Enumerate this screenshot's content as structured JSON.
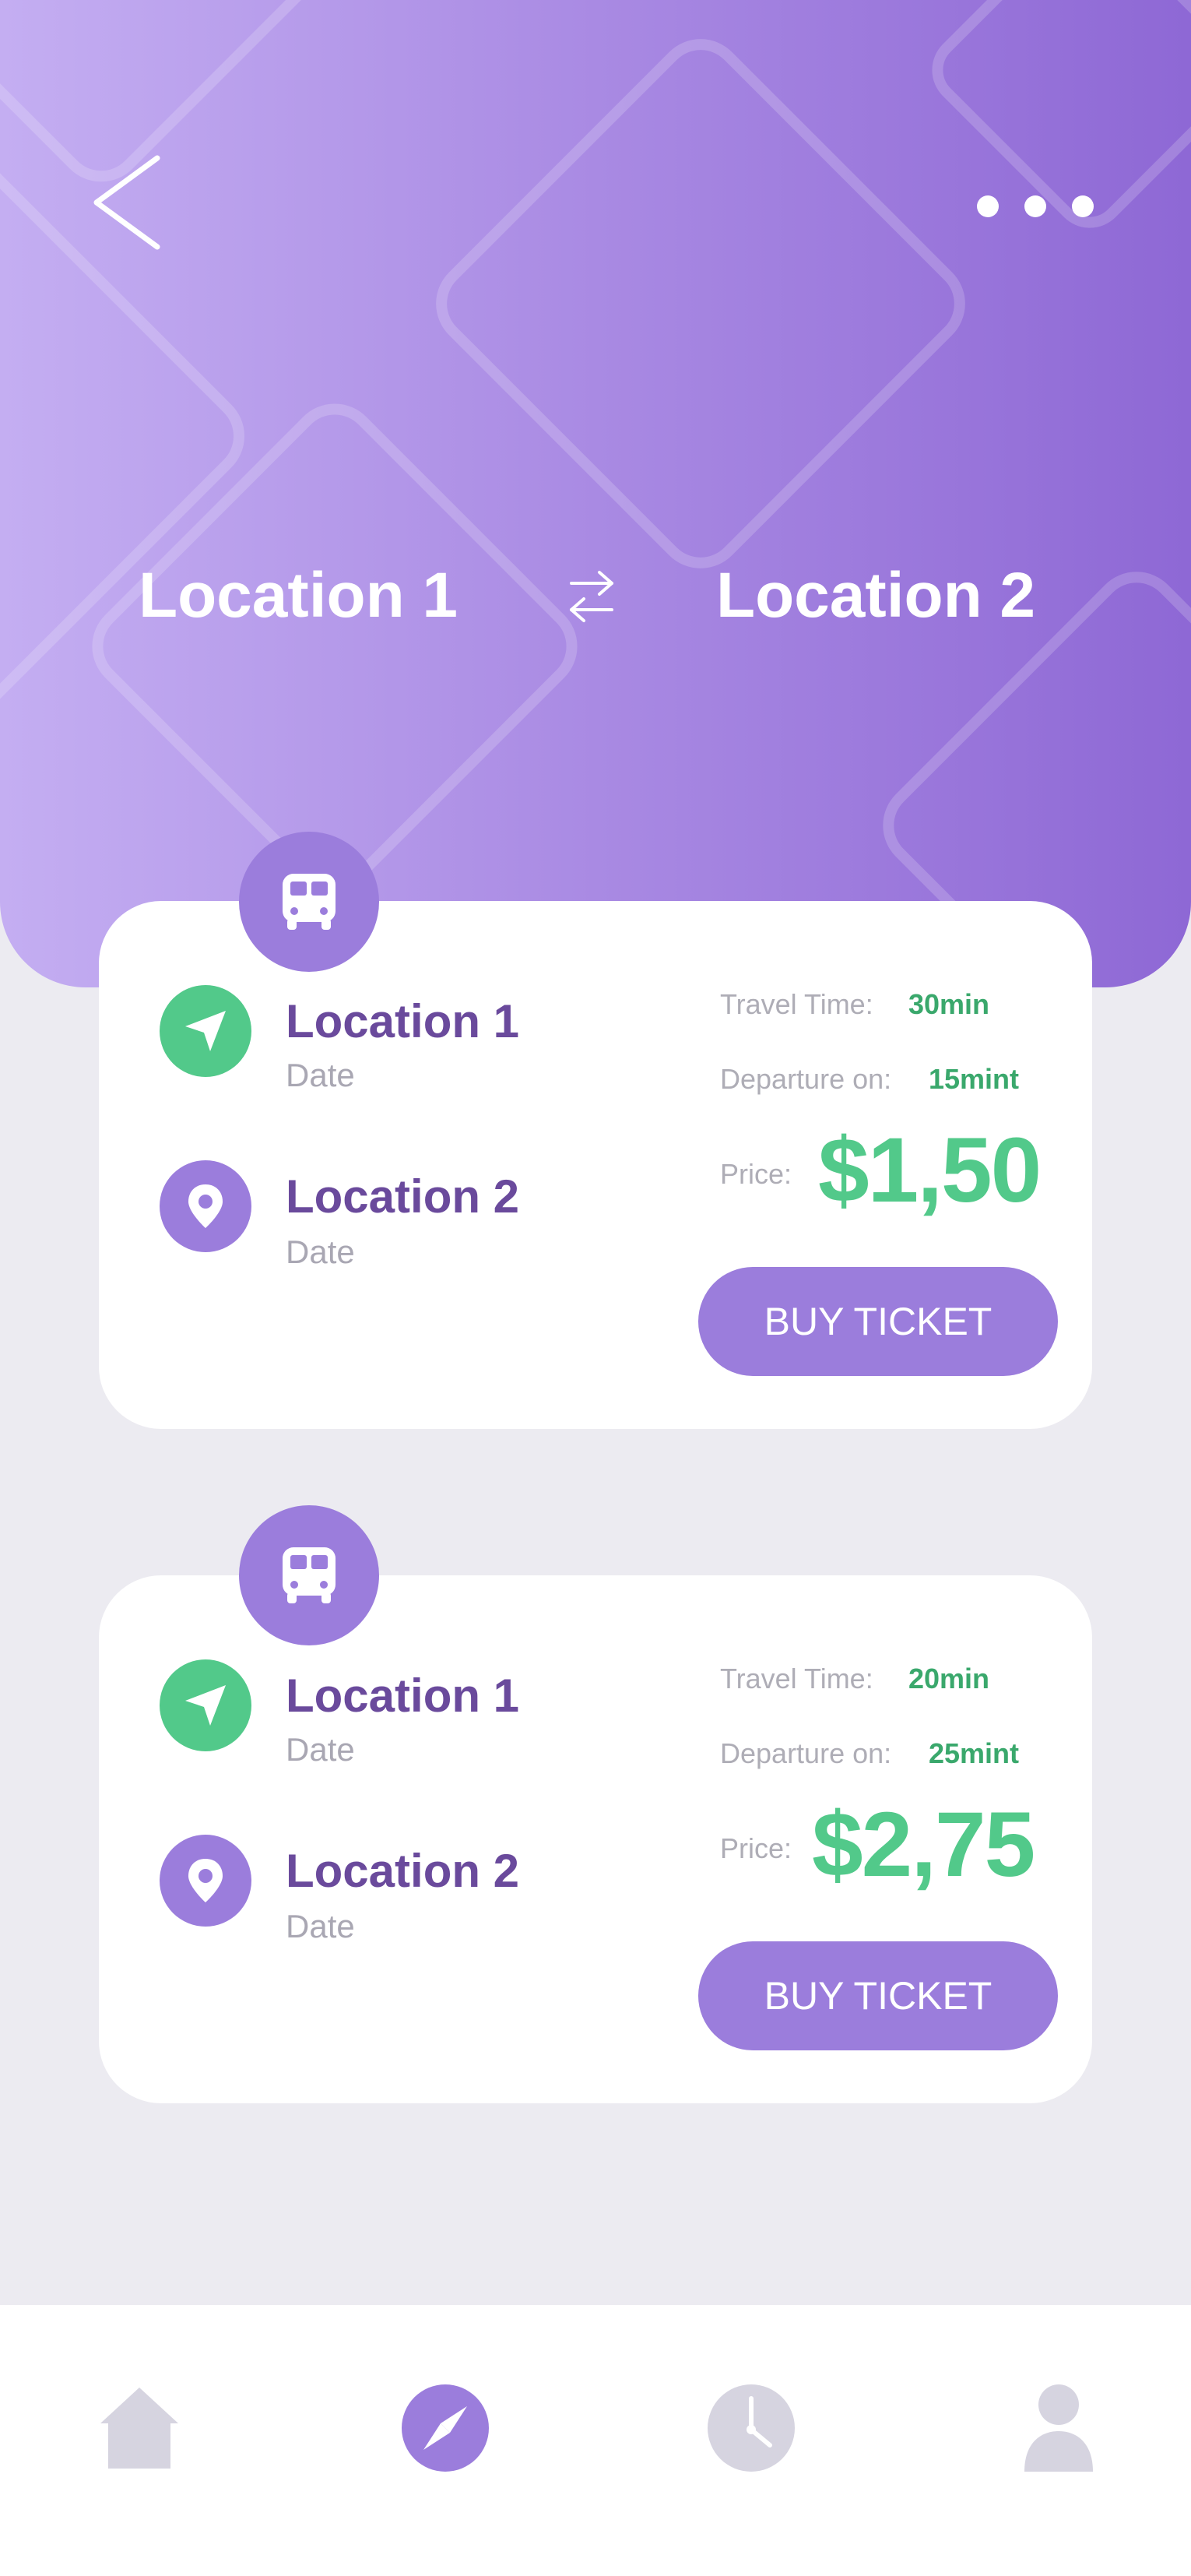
{
  "header": {
    "from_location": "Location 1",
    "to_location": "Location 2",
    "icons": {
      "back": "chevron-left-icon",
      "more": "more-dots-icon",
      "swap": "swap-arrows-icon"
    }
  },
  "trips": [
    {
      "from": {
        "name": "Location 1",
        "date": "Date"
      },
      "to": {
        "name": "Location 2",
        "date": "Date"
      },
      "travel_time_label": "Travel Time:",
      "travel_time": "30min",
      "departure_label": "Departure on:",
      "departure": "15mint",
      "price_label": "Price:",
      "price": "$1,50",
      "buy_label": "BUY TICKET"
    },
    {
      "from": {
        "name": "Location 1",
        "date": "Date"
      },
      "to": {
        "name": "Location 2",
        "date": "Date"
      },
      "travel_time_label": "Travel Time:",
      "travel_time": "20min",
      "departure_label": "Departure on:",
      "departure": "25mint",
      "price_label": "Price:",
      "price": "$2,75",
      "buy_label": "BUY TICKET"
    }
  ],
  "bottom_nav": {
    "items": [
      {
        "icon": "home-icon",
        "active": false
      },
      {
        "icon": "compass-icon",
        "active": true
      },
      {
        "icon": "clock-icon",
        "active": false
      },
      {
        "icon": "profile-icon",
        "active": false
      }
    ]
  },
  "colors": {
    "header_gradient_start": "#c4aef2",
    "header_gradient_end": "#8e68d5",
    "accent_purple": "#9b7ddc",
    "accent_green": "#52c98a",
    "title_purple": "#6a4a9c",
    "background": "#ecebf1",
    "nav_inactive": "#d6d4e0"
  }
}
